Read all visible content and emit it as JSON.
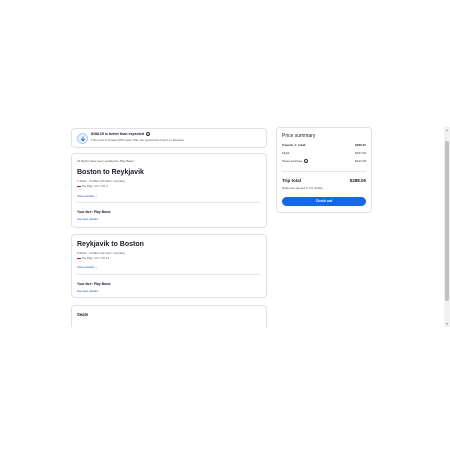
{
  "banner": {
    "title": "$288.05 is better than expected",
    "subtitle": "This price is at least 60% lower than the typical fare found on Expedia"
  },
  "flights": [
    {
      "notice": "All flights have been updated to Play Basic.",
      "route": "Boston to Reykjavik",
      "times": "7:15pm - 6:45am (5h 30m, nonstop)",
      "airline": "Fly Play • Fri, Oct 4",
      "details_label": "Show details",
      "fare": "Your fare: Play Basic",
      "fare_link": "See fare details"
    },
    {
      "route": "Reykjavik to Boston",
      "times": "5:50pm - 6:00pm (4h 10m, nonstop)",
      "airline": "Fly Play • Fri, Oct 11",
      "details_label": "Show details",
      "fare": "Your fare: Play Basic",
      "fare_link": "See fare details"
    }
  ],
  "seats": {
    "title": "Seats"
  },
  "summary": {
    "title": "Price summary",
    "traveler_label": "Traveler 1: Adult",
    "traveler_value": "$288.05",
    "flight_label": "Flight",
    "flight_value": "$167.00",
    "taxes_label": "Taxes and fees",
    "taxes_value": "$121.05",
    "total_label": "Trip total",
    "total_value": "$288.05",
    "rates_note": "Rates are quoted in US dollars",
    "checkout_label": "Check out"
  },
  "colors": {
    "accent": "#1668e3",
    "link": "#1a56db",
    "airline_mark": "#c8102e"
  }
}
